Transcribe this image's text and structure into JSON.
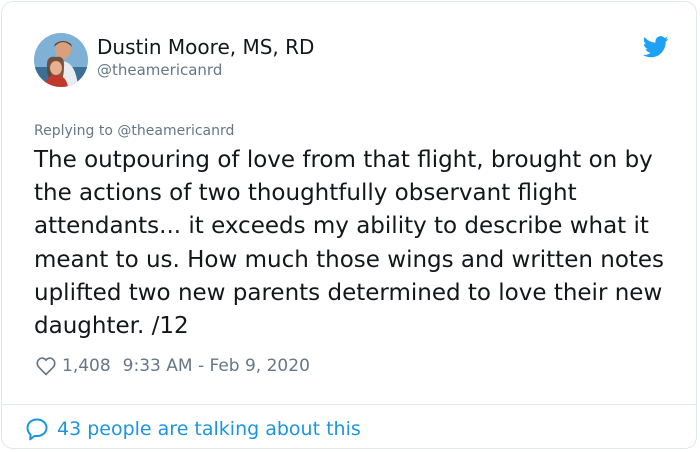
{
  "author": {
    "display_name": "Dustin Moore, MS, RD",
    "handle": "@theamericanrd",
    "avatar_icon": "user-avatar-photo"
  },
  "brand": {
    "icon": "twitter-bird-icon",
    "color": "#1da1f2"
  },
  "reply": {
    "prefix": "Replying to ",
    "target": "@theamericanrd"
  },
  "tweet": {
    "text": "The outpouring of love from that flight, brought on by the actions of two thoughtfully observant flight attendants... it exceeds my ability to describe what it meant to us. How much those wings and written notes uplifted two new parents determined to love their new daughter. /12"
  },
  "meta": {
    "like_icon": "heart-icon",
    "likes": "1,408",
    "timestamp": "9:33 AM - Feb 9, 2020"
  },
  "footer": {
    "icon": "speech-bubble-icon",
    "label": "43 people are talking about this",
    "link_color": "#1b95e0"
  }
}
